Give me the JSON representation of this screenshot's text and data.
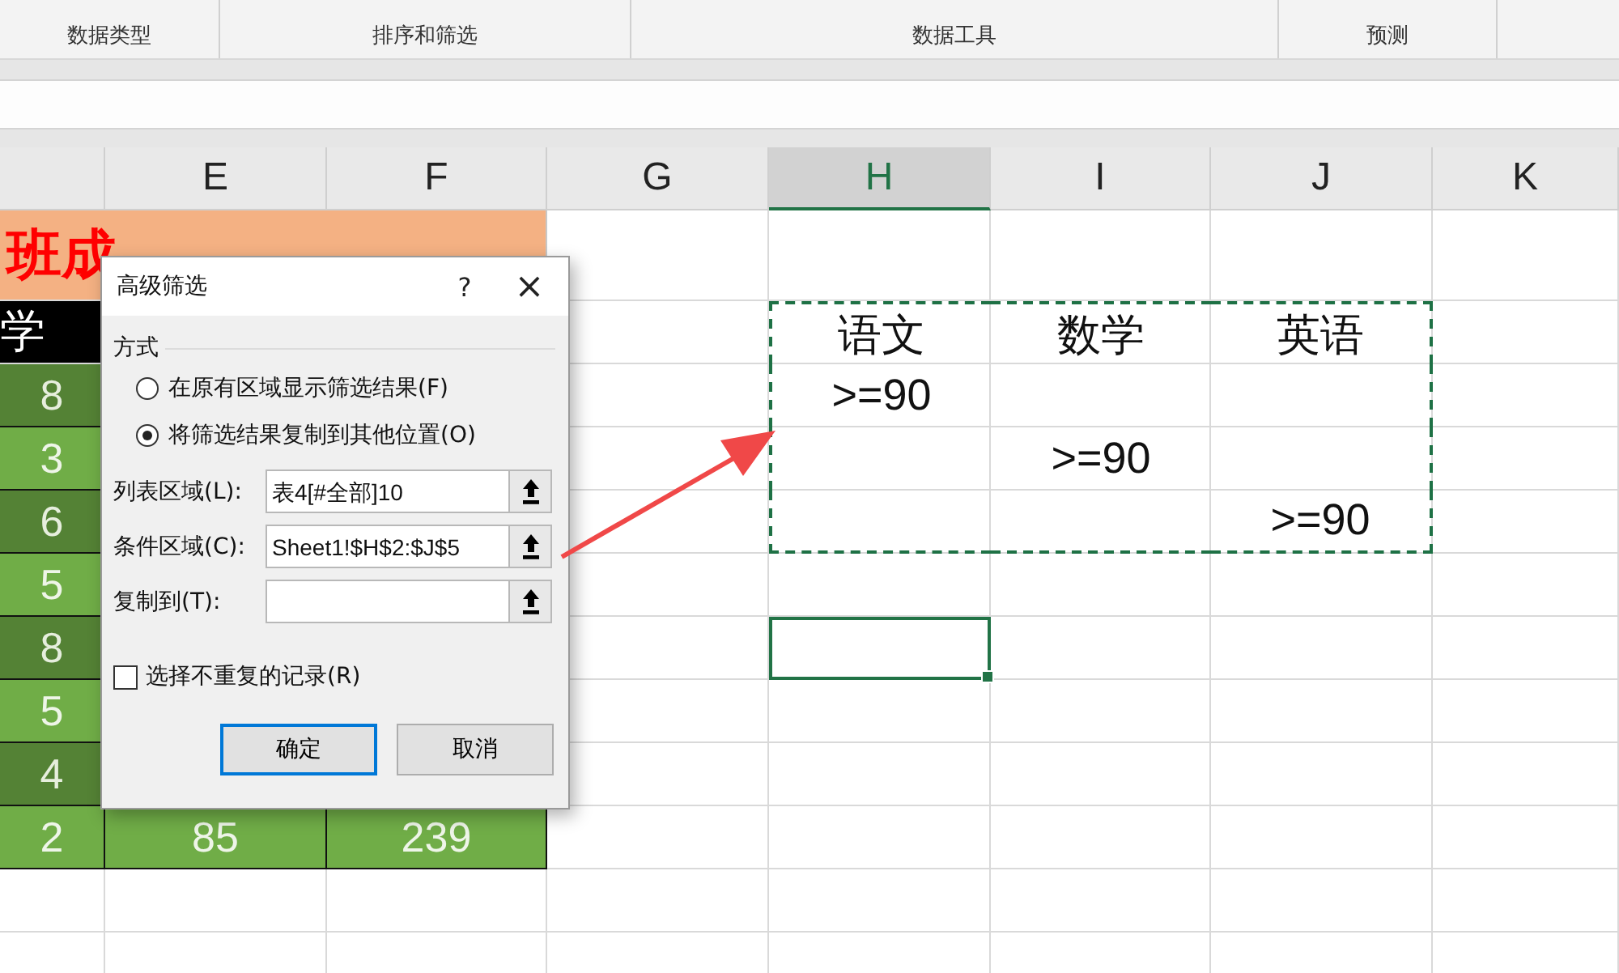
{
  "ribbon": {
    "groups": [
      {
        "label": "数据类型"
      },
      {
        "label": "排序和筛选"
      },
      {
        "label": "数据工具"
      },
      {
        "label": "预测"
      }
    ]
  },
  "columns": [
    {
      "selected": false
    },
    {
      "label": "E",
      "selected": false
    },
    {
      "label": "F",
      "selected": false
    },
    {
      "label": "G",
      "selected": false
    },
    {
      "label": "H",
      "selected": true
    },
    {
      "label": "I",
      "selected": false
    },
    {
      "label": "J",
      "selected": false
    },
    {
      "label": "K",
      "selected": false
    }
  ],
  "rows": [
    {
      "kind": "title",
      "cells": [
        {
          "kind": "title",
          "text": "班成"
        },
        {
          "kind": "empty"
        },
        {
          "kind": "empty"
        },
        {
          "kind": "empty"
        },
        {
          "kind": "empty"
        },
        {
          "kind": "empty"
        }
      ]
    },
    {
      "kind": "normal",
      "cells": [
        {
          "kind": "header",
          "text": "学"
        },
        {
          "kind": "empty"
        },
        {
          "kind": "empty"
        },
        {
          "kind": "empty"
        },
        {
          "kind": "plain",
          "text": "语文",
          "marked": true
        },
        {
          "kind": "plain",
          "text": "数学",
          "marked": true
        },
        {
          "kind": "plain",
          "text": "英语",
          "marked": true
        },
        {
          "kind": "empty"
        }
      ]
    },
    {
      "kind": "normal",
      "cells": [
        {
          "kind": "dark",
          "text": "8"
        },
        {
          "kind": "empty"
        },
        {
          "kind": "empty"
        },
        {
          "kind": "empty"
        },
        {
          "kind": "plain",
          "text": ">=90",
          "marked": true
        },
        {
          "kind": "empty"
        },
        {
          "kind": "empty",
          "marked": true
        },
        {
          "kind": "empty"
        }
      ]
    },
    {
      "kind": "normal",
      "cells": [
        {
          "kind": "light",
          "text": "3"
        },
        {
          "kind": "empty"
        },
        {
          "kind": "empty"
        },
        {
          "kind": "empty"
        },
        {
          "kind": "empty",
          "marked": true
        },
        {
          "kind": "plain",
          "text": ">=90",
          "marked": true
        },
        {
          "kind": "empty",
          "marked": true
        },
        {
          "kind": "empty"
        }
      ]
    },
    {
      "kind": "normal",
      "cells": [
        {
          "kind": "dark",
          "text": "6"
        },
        {
          "kind": "empty"
        },
        {
          "kind": "empty"
        },
        {
          "kind": "empty"
        },
        {
          "kind": "empty",
          "marked": true
        },
        {
          "kind": "empty",
          "marked": true
        },
        {
          "kind": "plain",
          "text": ">=90",
          "marked": true
        },
        {
          "kind": "empty"
        }
      ]
    },
    {
      "kind": "normal",
      "cells": [
        {
          "kind": "light",
          "text": "5"
        },
        {
          "kind": "empty"
        },
        {
          "kind": "empty"
        },
        {
          "kind": "empty"
        },
        {
          "kind": "empty"
        },
        {
          "kind": "empty"
        },
        {
          "kind": "empty"
        },
        {
          "kind": "empty"
        }
      ]
    },
    {
      "kind": "normal",
      "cells": [
        {
          "kind": "dark",
          "text": "8"
        },
        {
          "kind": "empty"
        },
        {
          "kind": "empty"
        },
        {
          "kind": "empty"
        },
        {
          "kind": "empty",
          "active": true
        },
        {
          "kind": "empty"
        },
        {
          "kind": "empty"
        },
        {
          "kind": "empty"
        }
      ]
    },
    {
      "kind": "normal",
      "cells": [
        {
          "kind": "light",
          "text": "5"
        },
        {
          "kind": "empty"
        },
        {
          "kind": "empty"
        },
        {
          "kind": "empty"
        },
        {
          "kind": "empty"
        },
        {
          "kind": "empty"
        },
        {
          "kind": "empty"
        },
        {
          "kind": "empty"
        }
      ]
    },
    {
      "kind": "normal",
      "cells": [
        {
          "kind": "dark",
          "text": "4"
        },
        {
          "kind": "empty"
        },
        {
          "kind": "empty"
        },
        {
          "kind": "empty"
        },
        {
          "kind": "empty"
        },
        {
          "kind": "empty"
        },
        {
          "kind": "empty"
        },
        {
          "kind": "empty"
        }
      ]
    },
    {
      "kind": "normal",
      "cells": [
        {
          "kind": "light",
          "text": "2"
        },
        {
          "kind": "light",
          "text": "85"
        },
        {
          "kind": "light",
          "text": "239"
        },
        {
          "kind": "empty"
        },
        {
          "kind": "empty"
        },
        {
          "kind": "empty"
        },
        {
          "kind": "empty"
        },
        {
          "kind": "empty"
        }
      ]
    },
    {
      "kind": "normal",
      "cells": [
        {
          "kind": "empty"
        },
        {
          "kind": "empty"
        },
        {
          "kind": "empty"
        },
        {
          "kind": "empty"
        },
        {
          "kind": "empty"
        },
        {
          "kind": "empty"
        },
        {
          "kind": "empty"
        },
        {
          "kind": "empty"
        }
      ]
    },
    {
      "kind": "normal",
      "cells": [
        {
          "kind": "empty"
        },
        {
          "kind": "empty"
        },
        {
          "kind": "empty"
        },
        {
          "kind": "empty"
        },
        {
          "kind": "empty"
        },
        {
          "kind": "empty"
        },
        {
          "kind": "empty"
        },
        {
          "kind": "empty"
        }
      ]
    }
  ],
  "dialog": {
    "title": "高级筛选",
    "help": "?",
    "close": "×",
    "group_label": "方式",
    "options": [
      {
        "label": "在原有区域显示筛选结果(F)",
        "selected": false
      },
      {
        "label": "将筛选结果复制到其他位置(O)",
        "selected": true
      }
    ],
    "fields": [
      {
        "label": "列表区域(L):",
        "value": "表4[#全部]10"
      },
      {
        "label": "条件区域(C):",
        "value": "Sheet1!$H$2:$J$5"
      },
      {
        "label": "复制到(T):"
      }
    ],
    "checkbox": {
      "label": "选择不重复的记录(R)",
      "checked": false
    },
    "buttons": [
      {
        "label": "确定",
        "focused": true
      },
      {
        "label": "取消",
        "focused": false
      }
    ]
  }
}
